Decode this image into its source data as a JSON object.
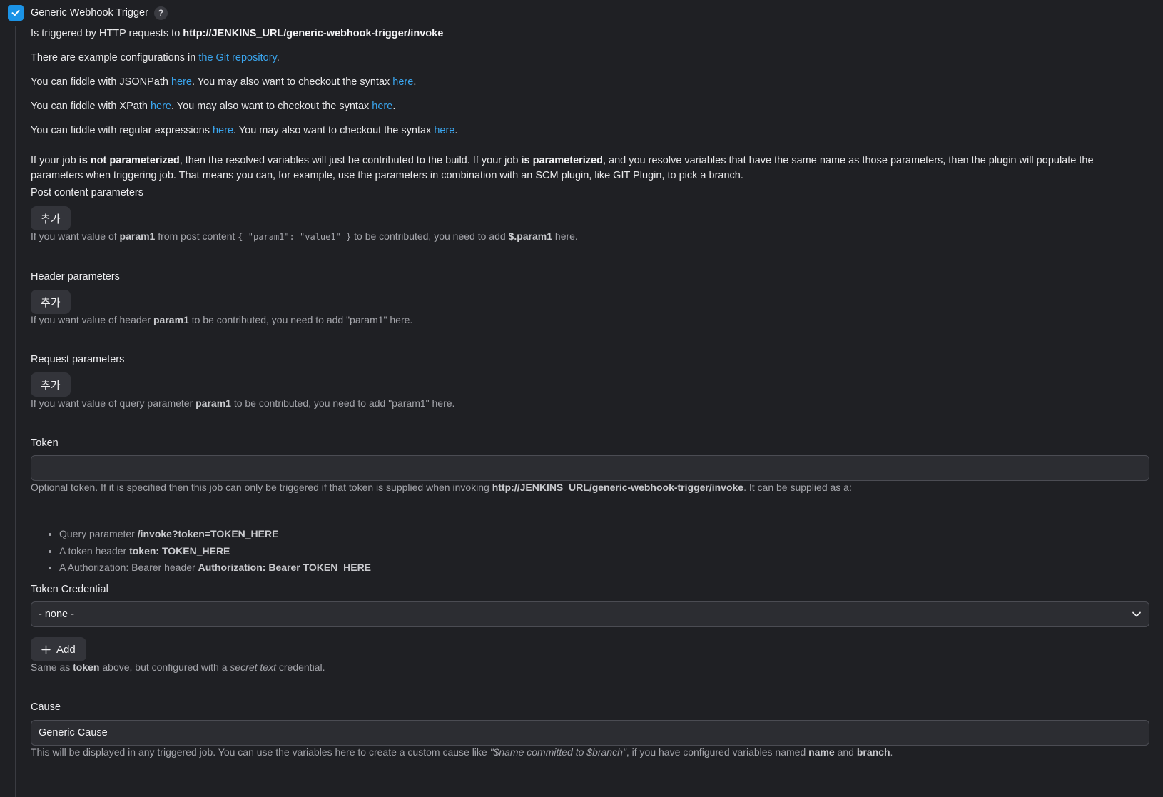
{
  "header": {
    "title": "Generic Webhook Trigger",
    "help": "?",
    "checked": true
  },
  "intro": {
    "triggered_prefix": "Is triggered by HTTP requests to ",
    "triggered_url": "http://JENKINS_URL/generic-webhook-trigger/invoke",
    "examples_prefix": "There are example configurations in ",
    "examples_link": "the Git repository",
    "examples_suffix": ".",
    "jsonpath_prefix": "You can fiddle with JSONPath ",
    "xpath_prefix": "You can fiddle with XPath ",
    "regex_prefix": "You can fiddle with regular expressions ",
    "here": "here",
    "syntax_middle": ". You may also want to checkout the syntax ",
    "period": "."
  },
  "param_info": {
    "t1": "If your job ",
    "b1": "is not parameterized",
    "t2": ", then the resolved variables will just be contributed to the build. If your job ",
    "b2": "is parameterized",
    "t3": ", and you resolve variables that have the same name as those parameters, then the plugin will populate the parameters when triggering job. That means you can, for example, use the parameters in combination with an SCM plugin, like GIT Plugin, to pick a branch."
  },
  "post_content": {
    "label": "Post content parameters",
    "button": "추가",
    "h1": "If you want value of ",
    "h_b1": "param1",
    "h2": " from post content ",
    "h_code": "{ \"param1\": \"value1\" }",
    "h3": " to be contributed, you need to add ",
    "h_b2": "$.param1",
    "h4": " here."
  },
  "header_params": {
    "label": "Header parameters",
    "button": "추가",
    "h1": "If you want value of header ",
    "h_b1": "param1",
    "h2": " to be contributed, you need to add \"param1\" here."
  },
  "request_params": {
    "label": "Request parameters",
    "button": "추가",
    "h1": "If you want value of query parameter ",
    "h_b1": "param1",
    "h2": " to be contributed, you need to add \"param1\" here."
  },
  "token": {
    "label": "Token",
    "value": "",
    "h1": "Optional token. If it is specified then this job can only be triggered if that token is supplied when invoking ",
    "h_b1": "http://JENKINS_URL/generic-webhook-trigger/invoke",
    "h2": ". It can be supplied as a:",
    "bullets": [
      {
        "text": "Query parameter ",
        "bold": "/invoke?token=TOKEN_HERE"
      },
      {
        "text": "A token header ",
        "bold": "token: TOKEN_HERE"
      },
      {
        "text": "A Authorization: Bearer header ",
        "bold": "Authorization: Bearer TOKEN_HERE"
      }
    ]
  },
  "token_credential": {
    "label": "Token Credential",
    "selected": "- none -",
    "add_button": "Add",
    "h1": "Same as ",
    "h_b1": "token",
    "h2": " above, but configured with a ",
    "h_i1": "secret text",
    "h3": " credential."
  },
  "cause": {
    "label": "Cause",
    "value": "Generic Cause",
    "h1": "This will be displayed in any triggered job. You can use the variables here to create a custom cause like ",
    "h_i1": "\"$name committed to $branch\"",
    "h2": ", if you have configured variables named ",
    "h_b1": "name",
    "h3": " and ",
    "h_b2": "branch",
    "h4": "."
  },
  "colors": {
    "background": "#1f2024",
    "accent": "#1b93e6",
    "link": "#3aa5ee",
    "muted_text": "#a4a5ab"
  }
}
